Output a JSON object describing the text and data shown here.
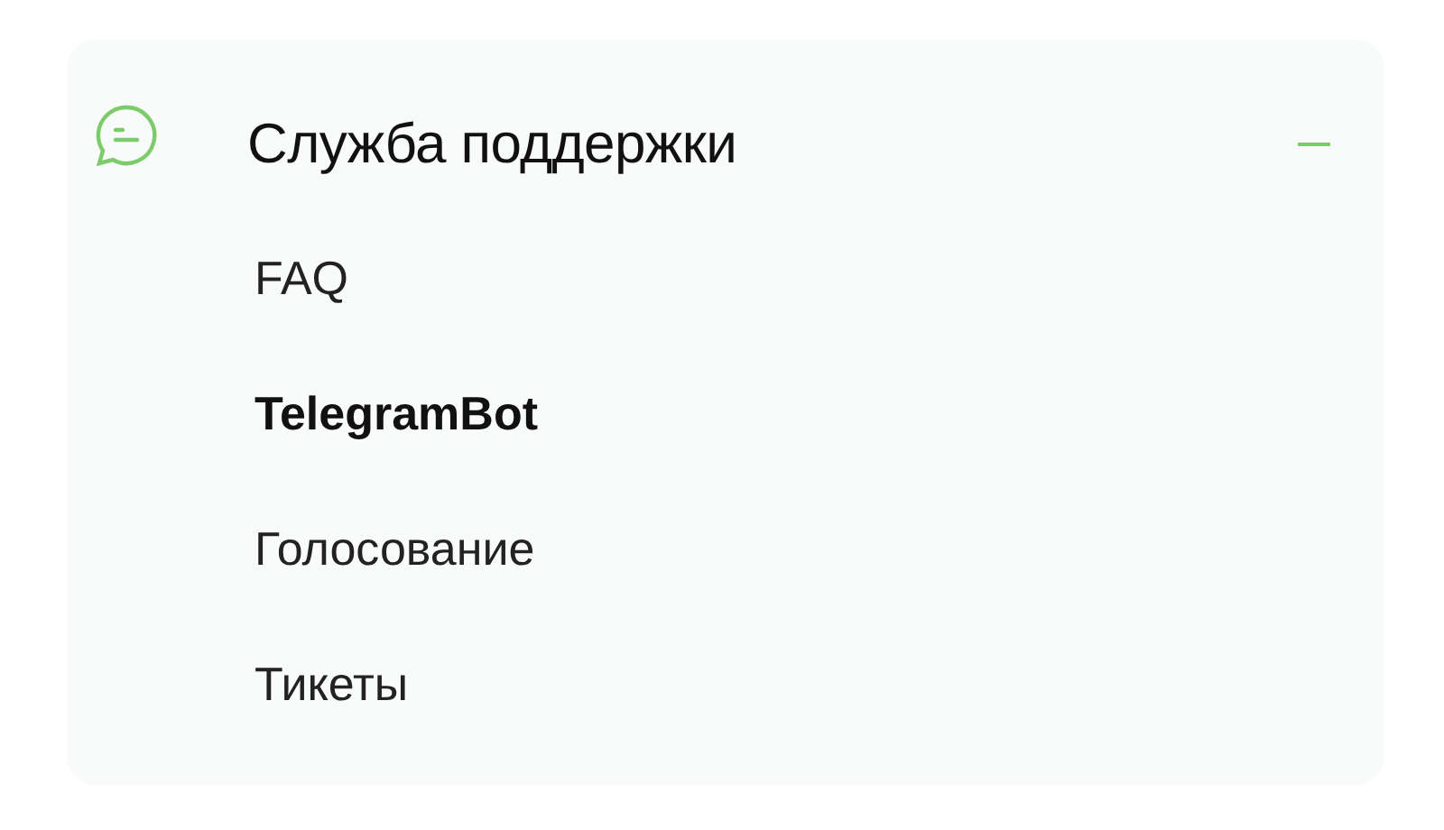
{
  "section": {
    "title": "Служба поддержки",
    "expanded": true,
    "items": [
      {
        "label": "FAQ",
        "selected": false
      },
      {
        "label": "TelegramBot",
        "selected": true
      },
      {
        "label": "Голосование",
        "selected": false
      },
      {
        "label": "Тикеты",
        "selected": false
      }
    ]
  }
}
